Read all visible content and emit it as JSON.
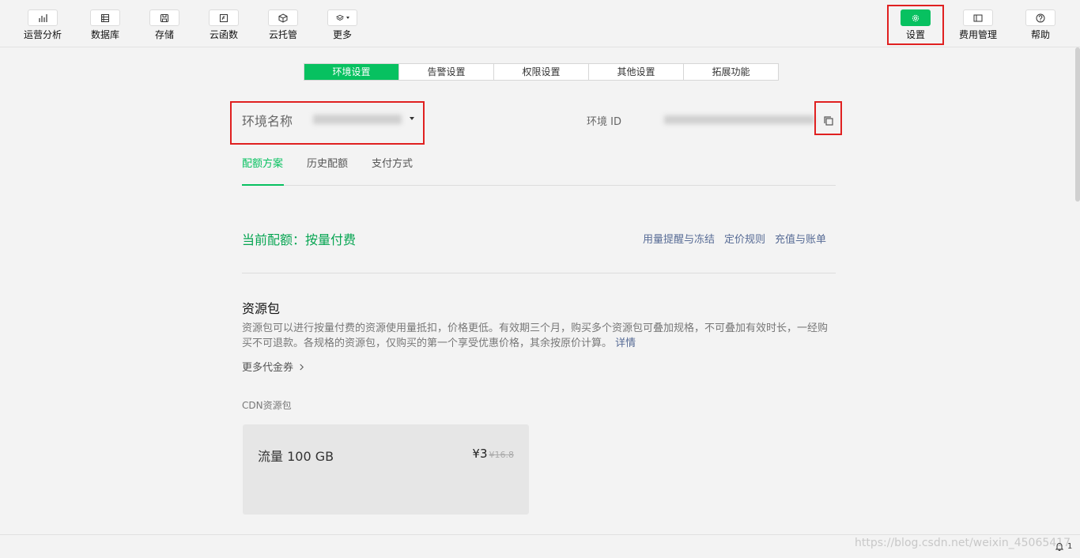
{
  "toolbar": {
    "items": [
      {
        "label": "运营分析",
        "icon": "bar-chart-icon"
      },
      {
        "label": "数据库",
        "icon": "database-icon"
      },
      {
        "label": "存储",
        "icon": "storage-icon"
      },
      {
        "label": "云函数",
        "icon": "function-icon"
      },
      {
        "label": "云托管",
        "icon": "cube-icon"
      },
      {
        "label": "更多",
        "icon": "layers-icon"
      }
    ],
    "right_items": [
      {
        "label": "设置",
        "icon": "gear-icon"
      },
      {
        "label": "费用管理",
        "icon": "billing-icon"
      },
      {
        "label": "帮助",
        "icon": "help-icon"
      }
    ]
  },
  "main_tabs": [
    "环境设置",
    "告警设置",
    "权限设置",
    "其他设置",
    "拓展功能"
  ],
  "env": {
    "name_label": "环境名称",
    "id_label": "环境 ID"
  },
  "sub_tabs": [
    "配额方案",
    "历史配额",
    "支付方式"
  ],
  "quota": {
    "current": "当前配额：按量付费",
    "links": [
      "用量提醒与冻结",
      "定价规则",
      "充值与账单"
    ]
  },
  "resource": {
    "title": "资源包",
    "desc": "资源包可以进行按量付费的资源使用量抵扣，价格更低。有效期三个月，购买多个资源包可叠加规格，不可叠加有效时长，一经购买不可退款。各规格的资源包，仅购买的第一个享受优惠价格，其余按原价计算。",
    "desc_link": "详情",
    "coupon_link": "更多代金券",
    "cdn_label": "CDN资源包",
    "card": {
      "title": "流量 100 GB",
      "price": "¥3",
      "old_price": "¥16.8"
    }
  },
  "footer": {
    "watermark": "https://blog.csdn.net/weixin_45065417",
    "notification_count": "1"
  },
  "colors": {
    "accent": "#07c160",
    "link": "#576b95",
    "highlight": "#e02020"
  }
}
